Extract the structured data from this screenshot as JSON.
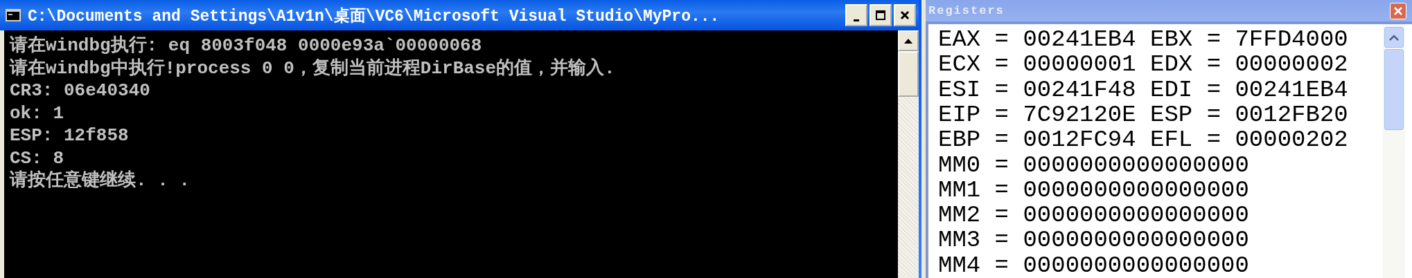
{
  "console": {
    "title": "C:\\Documents and Settings\\A1v1n\\桌面\\VC6\\Microsoft Visual Studio\\MyPro...",
    "lines": [
      "请在windbg执行: eq 8003f048 0000e93a`00000068",
      "请在windbg中执行!process 0 0，复制当前进程DirBase的值，并输入.",
      "CR3: 06e40340",
      "ok: 1",
      "ESP: 12f858",
      "CS: 8",
      "请按任意键继续. . ."
    ]
  },
  "registers": {
    "title": "Registers",
    "rows": [
      "EAX = 00241EB4 EBX = 7FFD4000",
      "ECX = 00000001 EDX = 00000002",
      "ESI = 00241F48 EDI = 00241EB4",
      "EIP = 7C92120E ESP = 0012FB20",
      "EBP = 0012FC94 EFL = 00000202",
      "MM0 = 0000000000000000",
      "MM1 = 0000000000000000",
      "MM2 = 0000000000000000",
      "MM3 = 0000000000000000",
      "MM4 = 0000000000000000"
    ]
  }
}
